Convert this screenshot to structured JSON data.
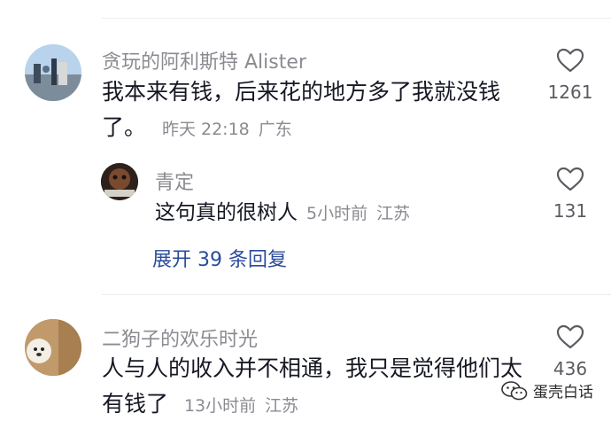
{
  "comments": [
    {
      "username": "贪玩的阿利斯特 Alister",
      "text_line1": "我本来有钱，后来花的地方多了我就没钱",
      "text_line2": "了。",
      "time": "昨天 22:18",
      "location": "广东",
      "likes": "1261"
    },
    {
      "username": "二狗子的欢乐时光",
      "text_line1": "人与人的收入并不相通，我只是觉得他们太",
      "text_line2": "有钱了",
      "time": "13小时前",
      "location": "江苏",
      "likes": "436"
    }
  ],
  "reply": {
    "username": "青定",
    "text": "这句真的很树人",
    "time": "5小时前",
    "location": "江苏",
    "likes": "131"
  },
  "expand_replies": "展开 39 条回复",
  "watermark": {
    "text": "蛋壳白话",
    "icon": "wechat-icon"
  },
  "colors": {
    "primary_text": "#161823",
    "secondary_text": "#8a8b91",
    "link": "#2b4b9b"
  }
}
